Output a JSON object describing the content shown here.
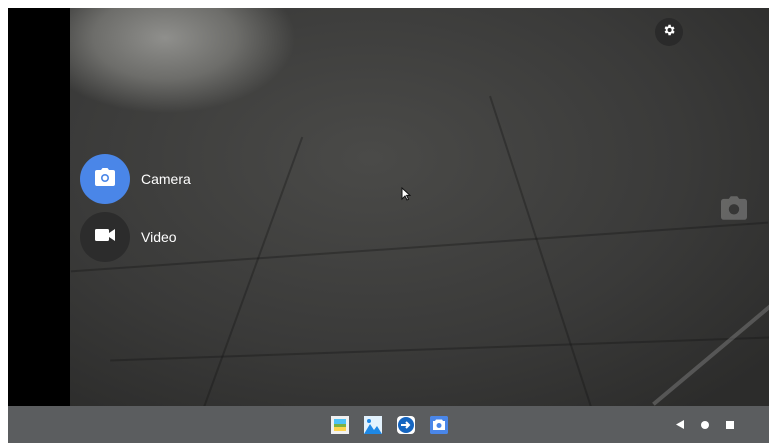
{
  "modes": {
    "camera": {
      "label": "Camera",
      "icon": "camera-icon",
      "selected": true,
      "accent": "#4a86e8"
    },
    "video": {
      "label": "Video",
      "icon": "video-icon",
      "selected": false
    }
  },
  "top_controls": {
    "settings_icon": "gear-icon"
  },
  "viewfinder": {
    "shutter_hint_icon": "camera-icon"
  },
  "taskbar": {
    "apps": [
      {
        "name": "image-viewer-app",
        "icon": "picture-frame-icon"
      },
      {
        "name": "gallery-app",
        "icon": "landscape-icon"
      },
      {
        "name": "remote-desktop-app",
        "icon": "arrow-circle-icon"
      },
      {
        "name": "camera-app",
        "icon": "camera-icon"
      }
    ],
    "nav": [
      "back-icon",
      "home-icon",
      "recents-icon"
    ]
  }
}
